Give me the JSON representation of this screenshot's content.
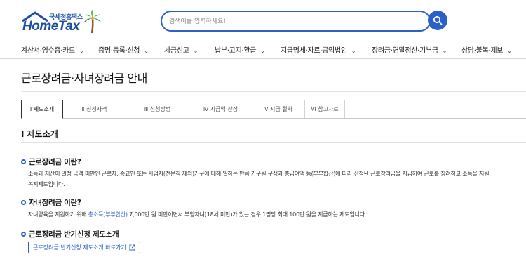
{
  "header": {
    "logo_sub": "국세청홈택스",
    "logo_main": "HomeTax",
    "search_placeholder": "검색어를 입력하세요!"
  },
  "nav": {
    "items": [
      {
        "label": "계산서·영수증·카드"
      },
      {
        "label": "증명·등록·신청"
      },
      {
        "label": "세금신고"
      },
      {
        "label": "납부·고지·환급"
      },
      {
        "label": "지급명세·자료·공익법인"
      },
      {
        "label": "장려금·연말정산·기부금"
      },
      {
        "label": "상담·불복·제보"
      }
    ]
  },
  "page": {
    "title": "근로장려금·자녀장려금 안내"
  },
  "tabs": [
    {
      "label": "Ⅰ 제도소개",
      "active": true
    },
    {
      "label": "Ⅱ 신청자격",
      "active": false
    },
    {
      "label": "Ⅲ 신청방법",
      "active": false
    },
    {
      "label": "Ⅳ 지급액 산정",
      "active": false
    },
    {
      "label": "Ⅴ 지급 절차",
      "active": false
    },
    {
      "label": "Ⅵ 참고자료",
      "active": false
    }
  ],
  "section": {
    "title": "Ⅰ 제도소개",
    "q1_title": "근로장려금 이란?",
    "q1_line1": "소득과 재산이 일정 금액 미만인 근로자, 종교인 또는 사업자(전문직 제외)가구에 대해 일하는 만큼 가구원 구성과 총급여액 등(부부합산)에 따라 산정된 근로장려금을 지급하여 근로를 장려하고 소득을 지원",
    "q1_line2": "복지제도입니다.",
    "q2_title": "자녀장려금 이란?",
    "q2_pre": "자녀양육을 지원하기 위해 ",
    "q2_link": "총소득(부부합산)",
    "q2_post": " 7,000만 원 미만이면서 부양자녀(18세 미만)가 있는 경우 1명당 최대 100만 원을 지급하는 제도입니다.",
    "q3_title": "근로장려금 반기신청 제도소개",
    "q3_button": "근로장려금 반기신청 제도소개 바로가기"
  },
  "colors": {
    "accent": "#2b5fc9",
    "brand": "#1d4e9e"
  }
}
